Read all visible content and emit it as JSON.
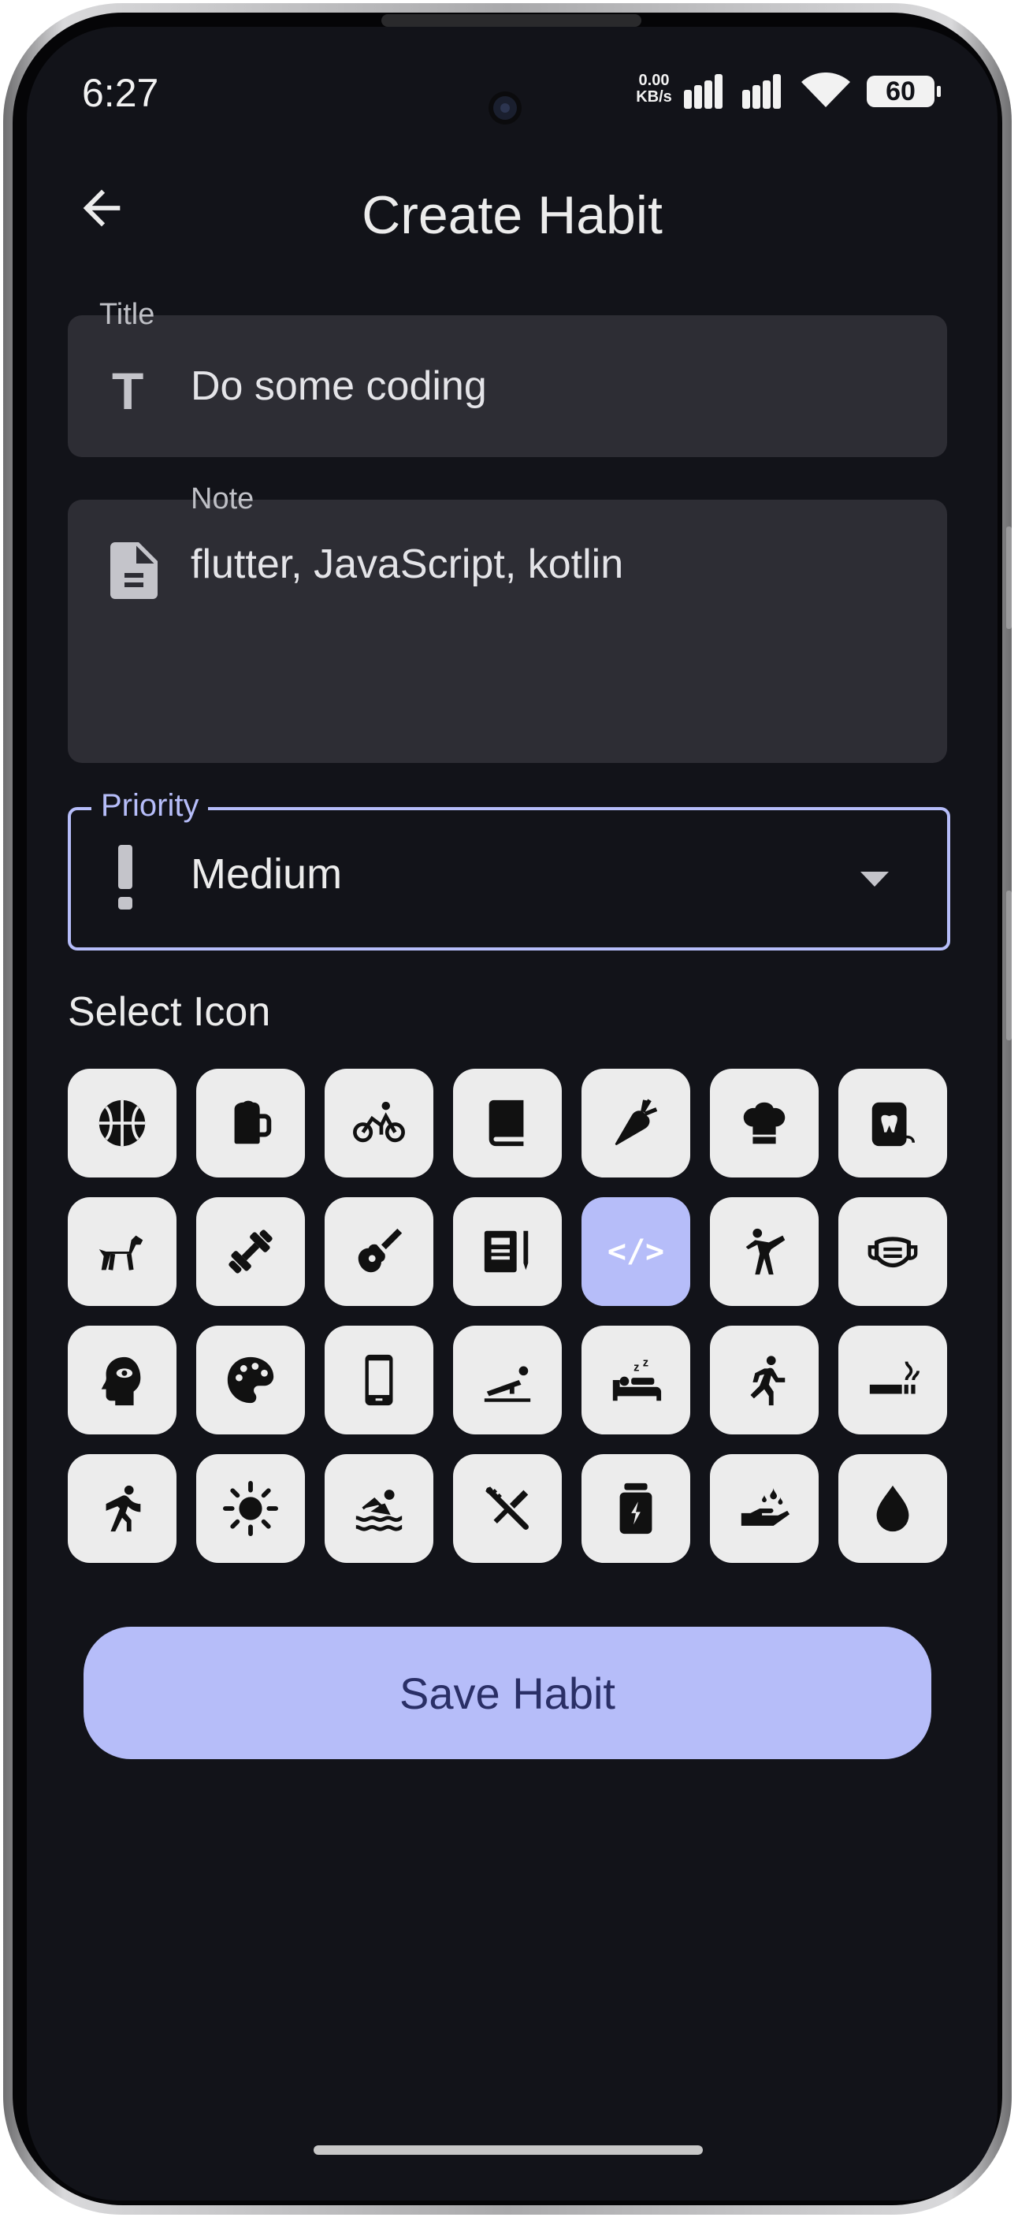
{
  "status_bar": {
    "time": "6:27",
    "net_speed_value": "0.00",
    "net_speed_unit": "KB/s",
    "battery": "60"
  },
  "app_bar": {
    "title": "Create Habit",
    "back_icon": "arrow-back-icon"
  },
  "form": {
    "title": {
      "label": "Title",
      "value": "Do some coding",
      "icon": "text-fields-icon"
    },
    "note": {
      "label": "Note",
      "value": "flutter, JavaScript, kotlin",
      "icon": "description-icon"
    },
    "priority": {
      "label": "Priority",
      "value": "Medium",
      "icon": "priority-high-icon"
    }
  },
  "select_icon": {
    "label": "Select Icon",
    "selected": "code",
    "selected_glyph": "</>",
    "icons": [
      [
        "basketball",
        "beer",
        "cycling",
        "book",
        "carrot",
        "chef-hat",
        "dental-floss"
      ],
      [
        "dog",
        "dumbbell",
        "guitar",
        "journal",
        "code",
        "martial-arts",
        "face-mask"
      ],
      [
        "mindfulness",
        "palette",
        "smartphone",
        "plank",
        "sleep",
        "running",
        "smoking"
      ],
      [
        "stretching",
        "sun",
        "swimming",
        "toothbrush",
        "supplements",
        "hand-wash",
        "water-drop"
      ]
    ]
  },
  "save_button": {
    "label": "Save Habit"
  },
  "colors": {
    "background": "#121319",
    "field": "#2d2d34",
    "accent": "#b6bdf9",
    "tile": "#ececec",
    "button_text": "#2a2f66"
  }
}
